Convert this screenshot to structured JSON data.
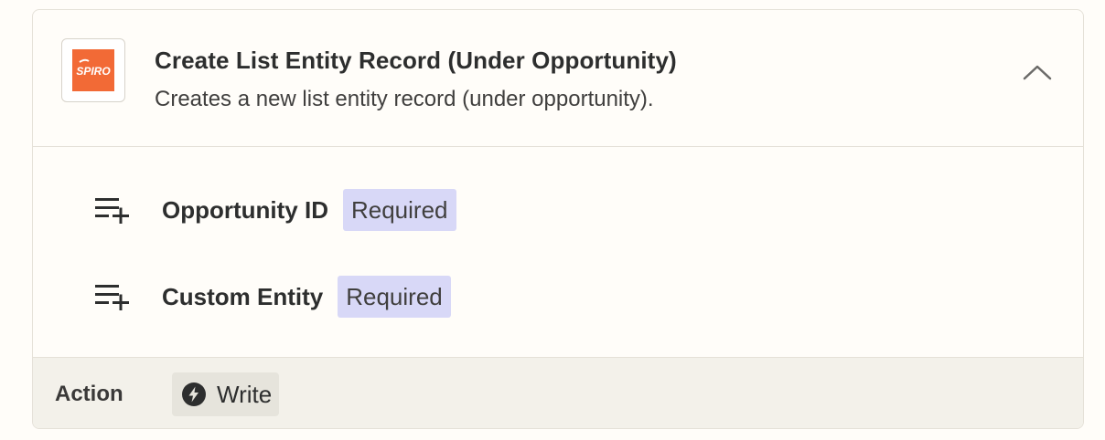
{
  "header": {
    "logo_text": "SPIRO",
    "title": "Create List Entity Record (Under Opportunity)",
    "subtitle": "Creates a new list entity record (under opportunity)."
  },
  "fields": [
    {
      "label": "Opportunity ID",
      "badge": "Required",
      "icon": "playlist-add-icon"
    },
    {
      "label": "Custom Entity",
      "badge": "Required",
      "icon": "playlist-add-icon"
    }
  ],
  "footer": {
    "label": "Action",
    "chip_label": "Write",
    "chip_icon": "bolt-icon"
  },
  "colors": {
    "brand": "#f26a36",
    "badge_bg": "#d8d8f7",
    "footer_bg": "#f3f1ea"
  }
}
